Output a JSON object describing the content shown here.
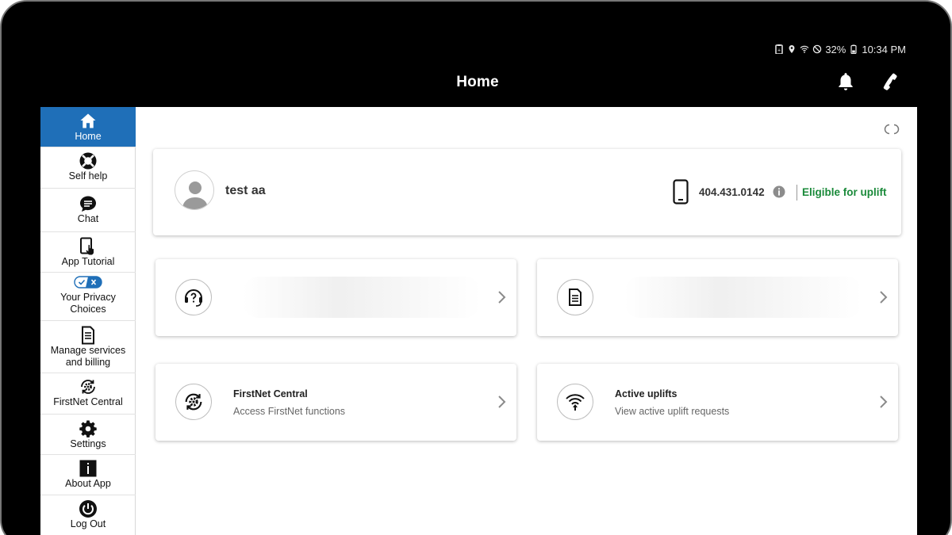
{
  "status_bar": {
    "battery": "32%",
    "time": "10:34 PM"
  },
  "header": {
    "title": "Home"
  },
  "sidebar": {
    "items": [
      {
        "label": "Home"
      },
      {
        "label": "Self help"
      },
      {
        "label": "Chat"
      },
      {
        "label": "App Tutorial"
      },
      {
        "label": "Your Privacy\nChoices"
      },
      {
        "label": "Manage services\nand billing"
      },
      {
        "label": "FirstNet Central"
      },
      {
        "label": "Settings"
      },
      {
        "label": "About App"
      },
      {
        "label": "Log Out"
      }
    ]
  },
  "profile": {
    "name": "test aa",
    "phone": "404.431.0142",
    "uplift_status": "Eligible for uplift"
  },
  "tiles": [
    {
      "title": "",
      "subtitle": ""
    },
    {
      "title": "",
      "subtitle": ""
    },
    {
      "title": "FirstNet Central",
      "subtitle": "Access FirstNet functions"
    },
    {
      "title": "Active uplifts",
      "subtitle": "View active uplift requests"
    }
  ],
  "colors": {
    "accent": "#1f6fb8",
    "eligible": "#1a8a3a"
  }
}
